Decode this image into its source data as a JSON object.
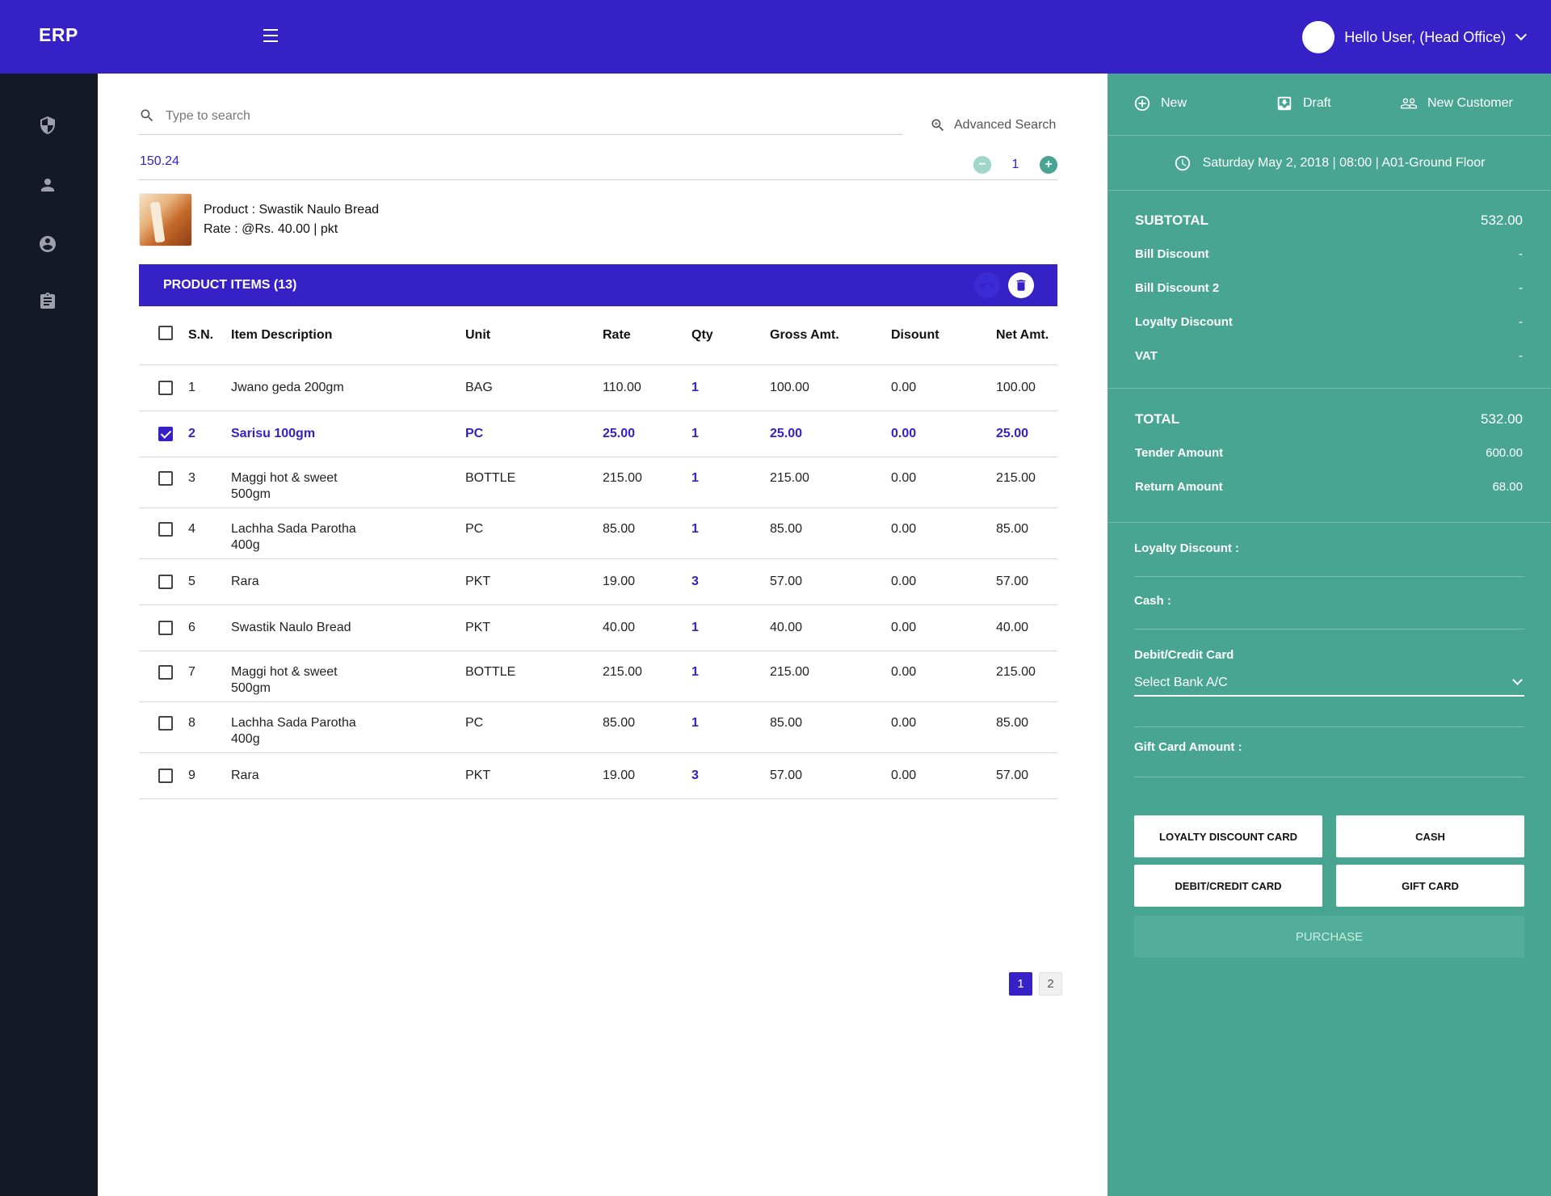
{
  "header": {
    "brand": "ERP",
    "user_greeting": "Hello User, (Head Office)"
  },
  "sidebar": {
    "items": [
      {
        "icon": "shield-icon"
      },
      {
        "icon": "person-icon"
      },
      {
        "icon": "account-circle-icon"
      },
      {
        "icon": "clipboard-icon"
      }
    ]
  },
  "search": {
    "placeholder": "Type to search",
    "advanced_label": "Advanced Search"
  },
  "quantity_row": {
    "value": "150.24",
    "stepper_value": "1"
  },
  "product": {
    "name_line": "Product : Swastik Naulo Bread",
    "rate_line": "Rate : @Rs. 40.00 | pkt"
  },
  "items_bar": {
    "title": "PRODUCT ITEMS (13)"
  },
  "table": {
    "headers": {
      "sn": "S.N.",
      "desc": "Item Description",
      "unit": "Unit",
      "rate": "Rate",
      "qty": "Qty",
      "gross": "Gross Amt.",
      "discount": "Disount",
      "net": "Net Amt."
    },
    "rows": [
      {
        "sn": "1",
        "desc": "Jwano geda 200gm",
        "unit": "BAG",
        "rate": "110.00",
        "qty": "1",
        "gross": "100.00",
        "discount": "0.00",
        "net": "100.00",
        "checked": false
      },
      {
        "sn": "2",
        "desc": "Sarisu 100gm",
        "unit": "PC",
        "rate": "25.00",
        "qty": "1",
        "gross": "25.00",
        "discount": "0.00",
        "net": "25.00",
        "checked": true
      },
      {
        "sn": "3",
        "desc": "Maggi hot & sweet\n500gm",
        "unit": "BOTTLE",
        "rate": "215.00",
        "qty": "1",
        "gross": "215.00",
        "discount": "0.00",
        "net": "215.00",
        "checked": false
      },
      {
        "sn": "4",
        "desc": "Lachha Sada Parotha\n400g",
        "unit": "PC",
        "rate": "85.00",
        "qty": "1",
        "gross": "85.00",
        "discount": "0.00",
        "net": "85.00",
        "checked": false
      },
      {
        "sn": "5",
        "desc": "Rara",
        "unit": "PKT",
        "rate": "19.00",
        "qty": "3",
        "gross": "57.00",
        "discount": "0.00",
        "net": "57.00",
        "checked": false
      },
      {
        "sn": "6",
        "desc": "Swastik Naulo Bread",
        "unit": "PKT",
        "rate": "40.00",
        "qty": "1",
        "gross": "40.00",
        "discount": "0.00",
        "net": "40.00",
        "checked": false
      },
      {
        "sn": "7",
        "desc": "Maggi hot & sweet\n500gm",
        "unit": "BOTTLE",
        "rate": "215.00",
        "qty": "1",
        "gross": "215.00",
        "discount": "0.00",
        "net": "215.00",
        "checked": false
      },
      {
        "sn": "8",
        "desc": "Lachha Sada Parotha\n400g",
        "unit": "PC",
        "rate": "85.00",
        "qty": "1",
        "gross": "85.00",
        "discount": "0.00",
        "net": "85.00",
        "checked": false
      },
      {
        "sn": "9",
        "desc": "Rara",
        "unit": "PKT",
        "rate": "19.00",
        "qty": "3",
        "gross": "57.00",
        "discount": "0.00",
        "net": "57.00",
        "checked": false
      }
    ]
  },
  "pagination": {
    "pages": [
      "1",
      "2"
    ],
    "active": "1"
  },
  "right_panel": {
    "actions": {
      "new": "New",
      "draft": "Draft",
      "new_customer": "New Customer"
    },
    "datetime": "Saturday May 2, 2018 | 08:00 | A01-Ground Floor",
    "summary": {
      "subtotal_label": "SUBTOTAL",
      "subtotal_value": "532.00",
      "bill_discount_label": "Bill Discount",
      "bill_discount_value": "-",
      "bill_discount2_label": "Bill Discount 2",
      "bill_discount2_value": "-",
      "loyalty_discount_label": "Loyalty Discount",
      "loyalty_discount_value": "-",
      "vat_label": "VAT",
      "vat_value": "-",
      "total_label": "TOTAL",
      "total_value": "532.00",
      "tender_label": "Tender Amount",
      "tender_value": "600.00",
      "return_label": "Return Amount",
      "return_value": "68.00"
    },
    "payment": {
      "loyalty_label": "Loyalty Discount :",
      "cash_label": "Cash :",
      "card_label": "Debit/Credit Card",
      "bank_select": "Select Bank A/C",
      "gift_label": "Gift Card Amount :"
    },
    "buttons": {
      "loyalty_card": "LOYALTY DISCOUNT CARD",
      "cash": "CASH",
      "debit_credit": "DEBIT/CREDIT CARD",
      "gift_card": "GIFT CARD",
      "purchase": "PURCHASE"
    }
  }
}
